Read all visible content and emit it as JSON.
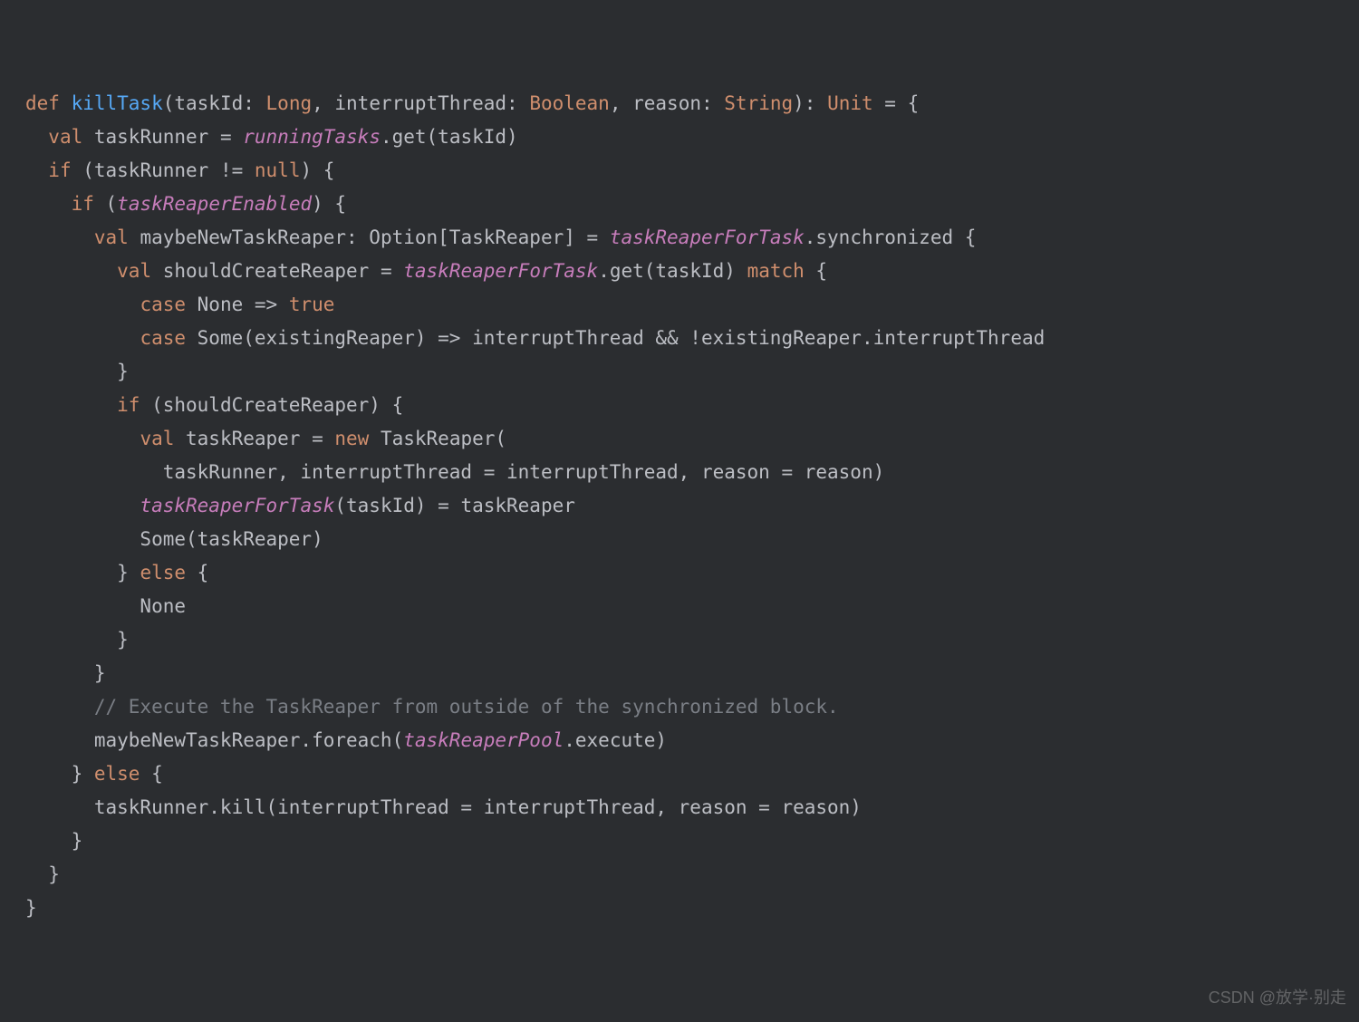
{
  "watermark": "CSDN @放学·别走",
  "code": {
    "lines": [
      [
        {
          "t": "def ",
          "c": "kw"
        },
        {
          "t": "killTask",
          "c": "fn"
        },
        {
          "t": "(taskId: ",
          "c": "id"
        },
        {
          "t": "Long",
          "c": "kw"
        },
        {
          "t": ", interruptThread: ",
          "c": "id"
        },
        {
          "t": "Boolean",
          "c": "kw"
        },
        {
          "t": ", reason: ",
          "c": "id"
        },
        {
          "t": "String",
          "c": "kw"
        },
        {
          "t": "): ",
          "c": "id"
        },
        {
          "t": "Unit",
          "c": "kw"
        },
        {
          "t": " = {",
          "c": "id"
        }
      ],
      [
        {
          "t": "  ",
          "c": "id"
        },
        {
          "t": "val ",
          "c": "kw"
        },
        {
          "t": "taskRunner = ",
          "c": "id"
        },
        {
          "t": "runningTasks",
          "c": "field"
        },
        {
          "t": ".get(taskId)",
          "c": "id"
        }
      ],
      [
        {
          "t": "  ",
          "c": "id"
        },
        {
          "t": "if ",
          "c": "kw"
        },
        {
          "t": "(taskRunner != ",
          "c": "id"
        },
        {
          "t": "null",
          "c": "kw"
        },
        {
          "t": ") {",
          "c": "id"
        }
      ],
      [
        {
          "t": "    ",
          "c": "id"
        },
        {
          "t": "if ",
          "c": "kw"
        },
        {
          "t": "(",
          "c": "id"
        },
        {
          "t": "taskReaperEnabled",
          "c": "field"
        },
        {
          "t": ") {",
          "c": "id"
        }
      ],
      [
        {
          "t": "      ",
          "c": "id"
        },
        {
          "t": "val ",
          "c": "kw"
        },
        {
          "t": "maybeNewTaskReaper: Option[TaskReaper] = ",
          "c": "id"
        },
        {
          "t": "taskReaperForTask",
          "c": "field"
        },
        {
          "t": ".synchronized {",
          "c": "id"
        }
      ],
      [
        {
          "t": "        ",
          "c": "id"
        },
        {
          "t": "val ",
          "c": "kw"
        },
        {
          "t": "shouldCreateReaper = ",
          "c": "id"
        },
        {
          "t": "taskReaperForTask",
          "c": "field"
        },
        {
          "t": ".get(taskId) ",
          "c": "id"
        },
        {
          "t": "match ",
          "c": "kw"
        },
        {
          "t": "{",
          "c": "id"
        }
      ],
      [
        {
          "t": "          ",
          "c": "id"
        },
        {
          "t": "case ",
          "c": "kw"
        },
        {
          "t": "None => ",
          "c": "id"
        },
        {
          "t": "true",
          "c": "kw"
        }
      ],
      [
        {
          "t": "          ",
          "c": "id"
        },
        {
          "t": "case ",
          "c": "kw"
        },
        {
          "t": "Some(existingReaper) => interruptThread && !existingReaper.interruptThread",
          "c": "id"
        }
      ],
      [
        {
          "t": "        }",
          "c": "id"
        }
      ],
      [
        {
          "t": "        ",
          "c": "id"
        },
        {
          "t": "if ",
          "c": "kw"
        },
        {
          "t": "(shouldCreateReaper) {",
          "c": "id"
        }
      ],
      [
        {
          "t": "          ",
          "c": "id"
        },
        {
          "t": "val ",
          "c": "kw"
        },
        {
          "t": "taskReaper = ",
          "c": "id"
        },
        {
          "t": "new ",
          "c": "kw"
        },
        {
          "t": "TaskReaper(",
          "c": "id"
        }
      ],
      [
        {
          "t": "            taskRunner, interruptThread = interruptThread, reason = reason)",
          "c": "id"
        }
      ],
      [
        {
          "t": "          ",
          "c": "id"
        },
        {
          "t": "taskReaperForTask",
          "c": "field"
        },
        {
          "t": "(taskId) = taskReaper",
          "c": "id"
        }
      ],
      [
        {
          "t": "          Some(taskReaper)",
          "c": "id"
        }
      ],
      [
        {
          "t": "        } ",
          "c": "id"
        },
        {
          "t": "else ",
          "c": "kw"
        },
        {
          "t": "{",
          "c": "id"
        }
      ],
      [
        {
          "t": "          None",
          "c": "id"
        }
      ],
      [
        {
          "t": "        }",
          "c": "id"
        }
      ],
      [
        {
          "t": "      }",
          "c": "id"
        }
      ],
      [
        {
          "t": "      ",
          "c": "id"
        },
        {
          "t": "// Execute the TaskReaper from outside of the synchronized block.",
          "c": "cmt"
        }
      ],
      [
        {
          "t": "      maybeNewTaskReaper.foreach(",
          "c": "id"
        },
        {
          "t": "taskReaperPool",
          "c": "field"
        },
        {
          "t": ".execute)",
          "c": "id"
        }
      ],
      [
        {
          "t": "    } ",
          "c": "id"
        },
        {
          "t": "else ",
          "c": "kw"
        },
        {
          "t": "{",
          "c": "id"
        }
      ],
      [
        {
          "t": "      taskRunner.kill(interruptThread = interruptThread, reason = reason)",
          "c": "id"
        }
      ],
      [
        {
          "t": "    }",
          "c": "id"
        }
      ],
      [
        {
          "t": "  }",
          "c": "id"
        }
      ],
      [
        {
          "t": "}",
          "c": "id"
        }
      ]
    ]
  }
}
